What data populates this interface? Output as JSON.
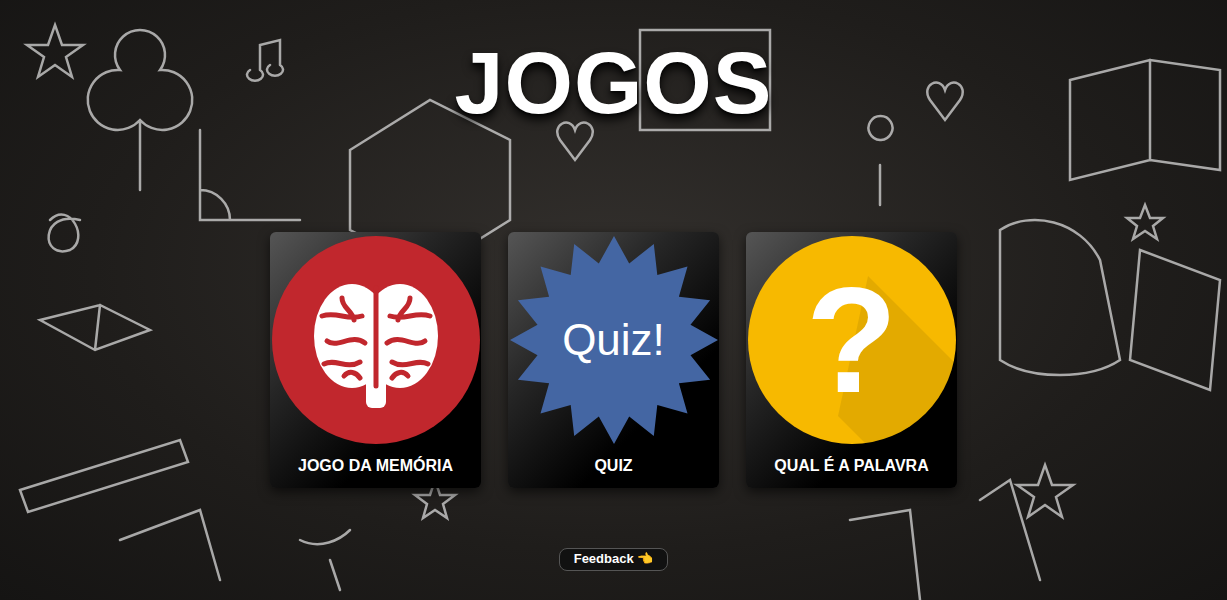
{
  "title": "JOGOS",
  "games": [
    {
      "label": "JOGO DA MEMÓRIA",
      "kind": "brain",
      "color": "#c1272d"
    },
    {
      "label": "QUIZ",
      "kind": "quiz",
      "color": "#4466a3",
      "icon_text": "Quiz!"
    },
    {
      "label": "QUAL É A PALAVRA",
      "kind": "question",
      "color": "#f7b900",
      "icon_text": "?"
    }
  ],
  "feedback": {
    "label": "Feedback 👈"
  }
}
